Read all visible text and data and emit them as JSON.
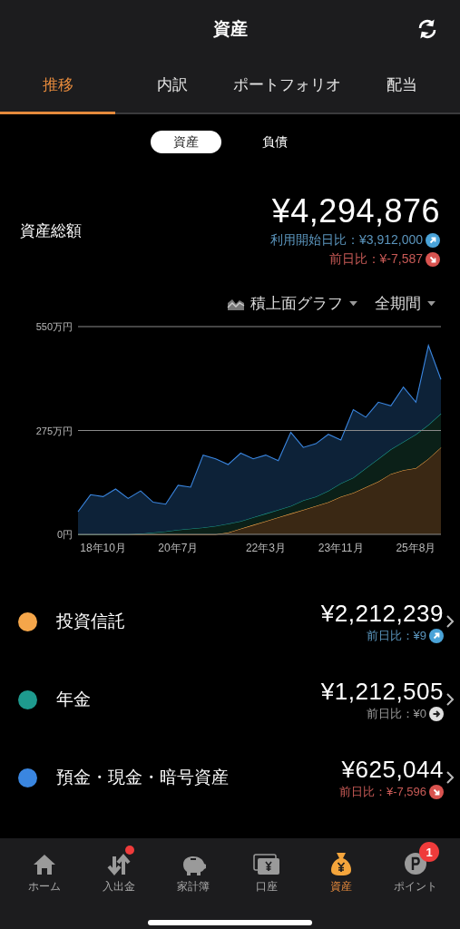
{
  "header": {
    "title": "資産"
  },
  "tabs": [
    {
      "label": "推移",
      "selected": true
    },
    {
      "label": "内訳",
      "selected": false
    },
    {
      "label": "ポートフォリオ",
      "selected": false
    },
    {
      "label": "配当",
      "selected": false
    }
  ],
  "segments": [
    {
      "label": "資産",
      "selected": true
    },
    {
      "label": "負債",
      "selected": false
    }
  ],
  "summary": {
    "label": "資産総額",
    "total": "¥4,294,876",
    "changes": [
      {
        "text": "利用開始日比：¥3,912,000",
        "kind": "up"
      },
      {
        "text": "前日比：¥-7,587",
        "kind": "down"
      }
    ]
  },
  "chart_controls": {
    "chart_type": "積上面グラフ",
    "period": "全期間"
  },
  "chart_data": {
    "type": "area",
    "stacked": true,
    "categories": [
      null,
      null,
      "18年10月",
      null,
      null,
      null,
      null,
      null,
      "20年7月",
      null,
      null,
      null,
      null,
      null,
      null,
      "22年3月",
      null,
      null,
      null,
      null,
      null,
      "23年11月",
      null,
      null,
      null,
      null,
      null,
      "25年8月",
      null,
      null
    ],
    "ylim": [
      0,
      550
    ],
    "yticks": [
      {
        "value": 0,
        "label": "0円"
      },
      {
        "value": 275,
        "label": "275万円"
      },
      {
        "value": 550,
        "label": "550万円"
      }
    ],
    "series": [
      {
        "color": "#f5a64a",
        "values": [
          0,
          0,
          0,
          0,
          0,
          0,
          0,
          0,
          0,
          0,
          0,
          0,
          5,
          15,
          25,
          35,
          45,
          55,
          65,
          75,
          85,
          100,
          110,
          125,
          140,
          160,
          170,
          175,
          200,
          230
        ]
      },
      {
        "color": "#1e9a8e",
        "values": [
          0,
          0,
          0,
          0,
          0,
          2,
          5,
          8,
          12,
          15,
          18,
          22,
          23,
          20,
          20,
          20,
          20,
          20,
          25,
          25,
          30,
          35,
          40,
          50,
          60,
          65,
          75,
          90,
          90,
          90
        ]
      },
      {
        "color": "#3a86e0",
        "values": [
          60,
          105,
          100,
          120,
          95,
          113,
          80,
          72,
          118,
          110,
          192,
          178,
          157,
          180,
          155,
          155,
          130,
          195,
          140,
          140,
          150,
          115,
          180,
          135,
          150,
          115,
          145,
          85,
          210,
          90
        ]
      }
    ]
  },
  "assets": [
    {
      "name": "投資信託",
      "color": "#f5a64a",
      "amount": "¥2,212,239",
      "change": "前日比：¥9",
      "kind": "up"
    },
    {
      "name": "年金",
      "color": "#1e9a8e",
      "amount": "¥1,212,505",
      "change": "前日比：¥0",
      "kind": "flat"
    },
    {
      "name": "預金・現金・暗号資産",
      "color": "#3a86e0",
      "amount": "¥625,044",
      "change": "前日比：¥-7,596",
      "kind": "down"
    }
  ],
  "nav": [
    {
      "label": "ホーム",
      "kind": "home",
      "selected": false
    },
    {
      "label": "入出金",
      "kind": "transfer",
      "selected": false,
      "dot": true
    },
    {
      "label": "家計簿",
      "kind": "piggy",
      "selected": false
    },
    {
      "label": "口座",
      "kind": "account",
      "selected": false
    },
    {
      "label": "資産",
      "kind": "bag",
      "selected": true
    },
    {
      "label": "ポイント",
      "kind": "point",
      "selected": false,
      "badge": "1"
    }
  ]
}
